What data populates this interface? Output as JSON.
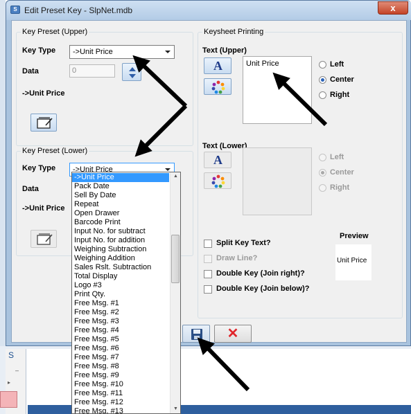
{
  "window": {
    "title": "Edit Preset Key - SlpNet.mdb",
    "close_glyph": "x"
  },
  "upper_preset": {
    "group_title": "Key Preset (Upper)",
    "key_type_label": "Key Type",
    "key_type_value": "->Unit Price",
    "data_label": "Data",
    "data_value": "0",
    "key_type_caption": "->Unit Price"
  },
  "lower_preset": {
    "group_title": "Key Preset (Lower)",
    "key_type_label": "Key Type",
    "key_type_value": "->Unit Price",
    "data_label": "Data",
    "key_type_caption": "->Unit Price"
  },
  "dropdown": {
    "items": [
      "->Unit Price",
      "Pack Date",
      "Sell By Date",
      "Repeat",
      "Open Drawer",
      "Barcode Print",
      "Input No. for subtract",
      "Input No. for addition",
      "Weighing Subtraction",
      "Weighing Addition",
      "Sales Rslt. Subtraction",
      "Total Display",
      "Logo #3",
      "Print Qty.",
      "Free Msg. #1",
      "Free Msg. #2",
      "Free Msg. #3",
      "Free Msg. #4",
      "Free Msg. #5",
      "Free Msg. #6",
      "Free Msg. #7",
      "Free Msg. #8",
      "Free Msg. #9",
      "Free Msg. #10",
      "Free Msg. #11",
      "Free Msg. #12",
      "Free Msg. #13"
    ]
  },
  "keysheet": {
    "group_title": "Keysheet Printing",
    "text_upper_label": "Text (Upper)",
    "text_upper_value": "Unit Price",
    "text_lower_label": "Text (Lower)",
    "font_button_glyph": "A",
    "align_upper": {
      "left": "Left",
      "center": "Center",
      "right": "Right",
      "selected": "center"
    },
    "align_lower": {
      "left": "Left",
      "center": "Center",
      "right": "Right",
      "selected": "center"
    },
    "split_key_text": "Split Key Text?",
    "draw_line": "Draw Line?",
    "double_key_right": "Double Key (Join right)?",
    "double_key_below": "Double Key (Join below)?",
    "preview_label": "Preview",
    "preview_text": "Unit Price"
  },
  "buttons": {
    "cancel_glyph": "✕"
  },
  "background_app": {
    "left_letter": "S"
  },
  "colors": {
    "accent": "#3399ff",
    "arrow": "#000000",
    "cancel": "#e0262b"
  }
}
